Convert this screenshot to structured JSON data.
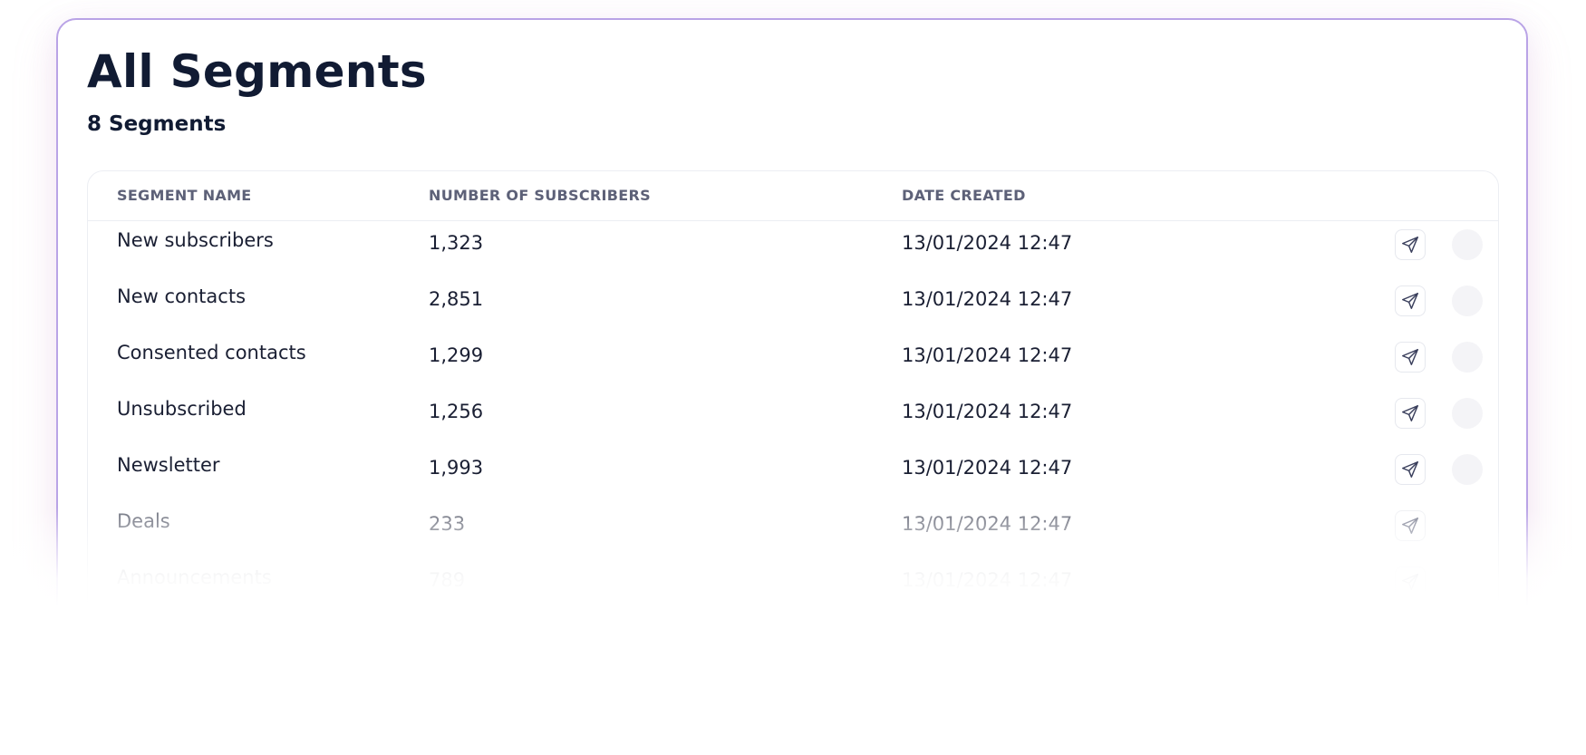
{
  "page": {
    "title": "All Segments",
    "count_label": "8 Segments"
  },
  "table": {
    "headers": {
      "name": "SEGMENT NAME",
      "subscribers": "NUMBER OF SUBSCRIBERS",
      "date": "DATE CREATED"
    },
    "rows": [
      {
        "name": "New subscribers",
        "subscribers": "1,323",
        "date": "13/01/2024 12:47"
      },
      {
        "name": "New contacts",
        "subscribers": "2,851",
        "date": "13/01/2024 12:47"
      },
      {
        "name": "Consented contacts",
        "subscribers": "1,299",
        "date": "13/01/2024 12:47"
      },
      {
        "name": "Unsubscribed",
        "subscribers": "1,256",
        "date": "13/01/2024 12:47"
      },
      {
        "name": "Newsletter",
        "subscribers": "1,993",
        "date": "13/01/2024 12:47"
      },
      {
        "name": "Deals",
        "subscribers": "233",
        "date": "13/01/2024 12:47"
      },
      {
        "name": "Announcements",
        "subscribers": "789",
        "date": "13/01/2024 12:47"
      }
    ],
    "row_actions": {
      "send_icon": "send-icon",
      "more_icon": "more-actions-icon"
    }
  },
  "colors": {
    "card_border": "#b9a3e6",
    "text_primary": "#111b33",
    "header_text": "#5d6178",
    "icon_stroke": "#3a3f5c"
  }
}
